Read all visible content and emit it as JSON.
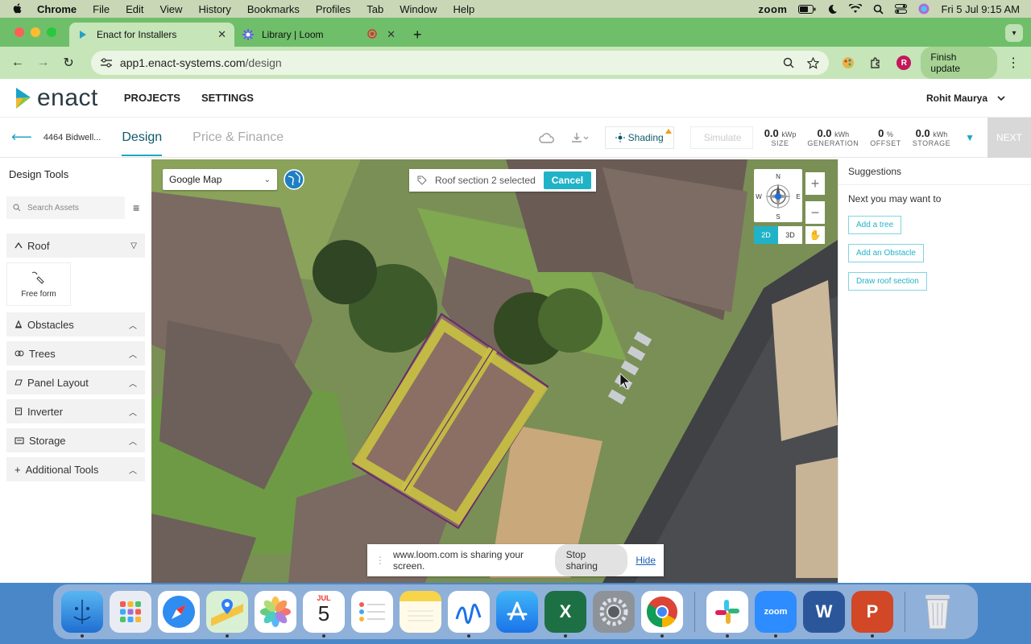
{
  "menubar": {
    "items": [
      "Chrome",
      "File",
      "Edit",
      "View",
      "History",
      "Bookmarks",
      "Profiles",
      "Tab",
      "Window",
      "Help"
    ],
    "zoom": "zoom",
    "datetime": "Fri 5 Jul  9:15 AM"
  },
  "browser": {
    "tabs": [
      {
        "title": "Enact for Installers"
      },
      {
        "title": "Library | Loom"
      }
    ],
    "url_host": "app1.enact-systems.com",
    "url_path": "/design",
    "profile_initial": "R",
    "finish_update": "Finish update"
  },
  "app": {
    "logo": "enact",
    "nav": [
      "PROJECTS",
      "SETTINGS"
    ],
    "user": "Rohit Maurya"
  },
  "subheader": {
    "address": "4464 Bidwell...",
    "tab_design": "Design",
    "tab_price": "Price & Finance",
    "shading": "Shading",
    "simulate": "Simulate",
    "stats": [
      {
        "value": "0.0",
        "unit": "kWp",
        "label": "SIZE"
      },
      {
        "value": "0.0",
        "unit": "kWh",
        "label": "GENERATION"
      },
      {
        "value": "0",
        "unit": "%",
        "label": "OFFSET"
      },
      {
        "value": "0.0",
        "unit": "kWh",
        "label": "STORAGE"
      }
    ],
    "next": "NEXT"
  },
  "tools": {
    "title": "Design Tools",
    "search_placeholder": "Search Assets",
    "roof": "Roof",
    "free_form": "Free form",
    "sections": [
      "Obstacles",
      "Trees",
      "Panel Layout",
      "Inverter",
      "Storage",
      "Additional Tools"
    ]
  },
  "map": {
    "type": "Google Map",
    "selection_text": "Roof section 2 selected",
    "cancel": "Cancel",
    "compass": {
      "n": "N",
      "s": "S",
      "e": "E",
      "w": "W"
    },
    "view_2d": "2D",
    "view_3d": "3D",
    "loom_text": "www.loom.com is sharing your screen.",
    "stop_sharing": "Stop sharing",
    "hide": "Hide"
  },
  "suggestions": {
    "title": "Suggestions",
    "subtitle": "Next you may want to",
    "buttons": [
      "Add a tree",
      "Add an Obstacle",
      "Draw roof section"
    ]
  },
  "dock": {
    "calendar_month": "JUL",
    "calendar_day": "5",
    "zoom": "zoom"
  }
}
